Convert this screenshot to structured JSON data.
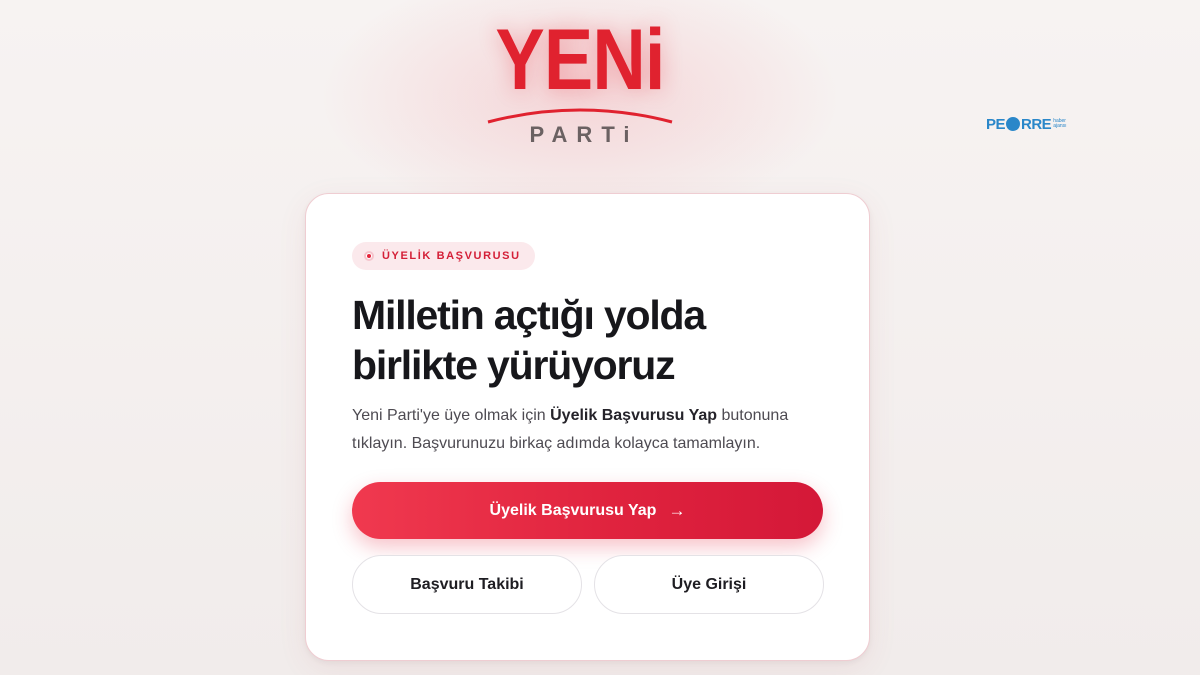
{
  "logo": {
    "wordmark": "YENi",
    "subtitle": "PARTi"
  },
  "watermark": {
    "text_left": "PE",
    "text_right": "RRE",
    "small_text": "haber ajansı"
  },
  "card": {
    "badge": "ÜYELİK BAŞVURUSU",
    "headline": {
      "line1": "Milletin açtığı yolda",
      "line2": "birlikte yürüyoruz"
    },
    "description": {
      "part1": "Yeni Parti'ye üye olmak için ",
      "bold": "Üyelik Başvurusu Yap",
      "part2": " butonuna tıklayın. Başvurunuzu birkaç adımda kolayca tamamlayın."
    },
    "primary_button": {
      "label": "Üyelik Başvurusu Yap",
      "arrow": "→"
    },
    "track_button": "Başvuru Takibi",
    "login_button": "Üye Girişi"
  },
  "colors": {
    "brand_red": "#e0222f",
    "button_red": "#e0233e",
    "heading": "#17171b"
  },
  "icons": {
    "badge": "record-dot-icon",
    "primary_button": "arrow-right-icon"
  }
}
